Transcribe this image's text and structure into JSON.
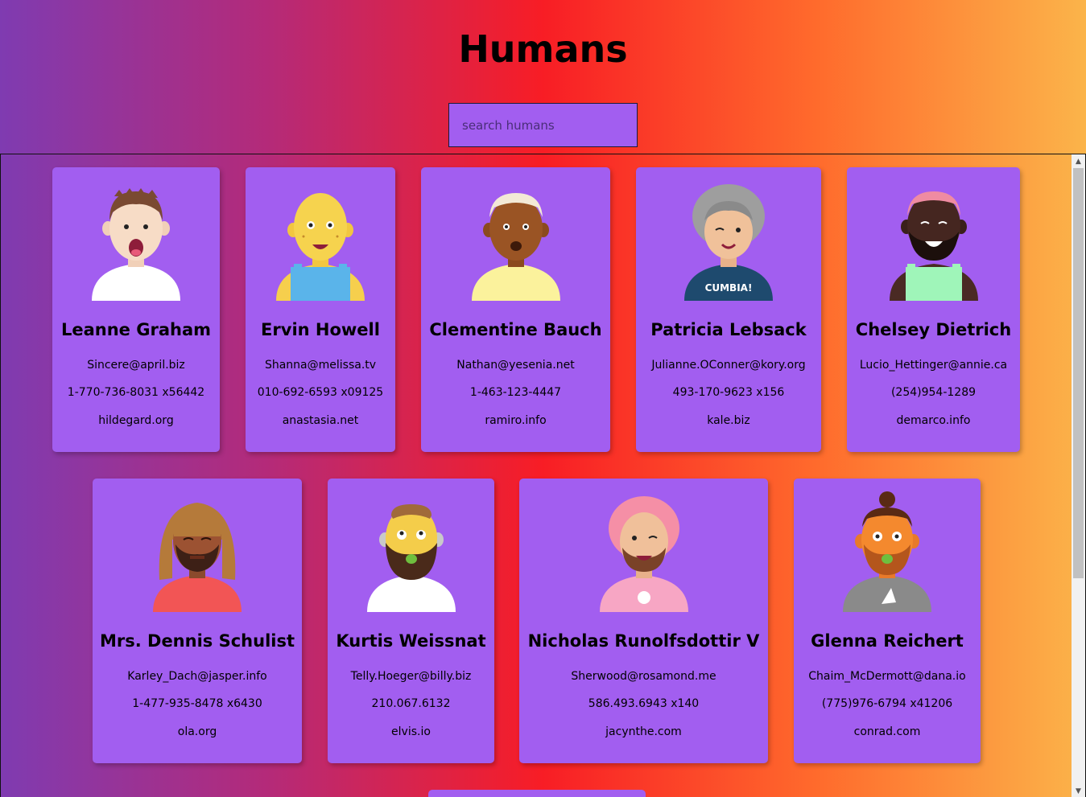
{
  "header": {
    "title": "Humans"
  },
  "search": {
    "placeholder": "search humans",
    "value": ""
  },
  "cards": [
    {
      "name": "Leanne Graham",
      "email": "Sincere@april.biz",
      "phone": "1-770-736-8031 x56442",
      "website": "hildegard.org"
    },
    {
      "name": "Ervin Howell",
      "email": "Shanna@melissa.tv",
      "phone": "010-692-6593 x09125",
      "website": "anastasia.net"
    },
    {
      "name": "Clementine Bauch",
      "email": "Nathan@yesenia.net",
      "phone": "1-463-123-4447",
      "website": "ramiro.info"
    },
    {
      "name": "Patricia Lebsack",
      "email": "Julianne.OConner@kory.org",
      "phone": "493-170-9623 x156",
      "website": "kale.biz",
      "shirt_text": "CUMBIA!"
    },
    {
      "name": "Chelsey Dietrich",
      "email": "Lucio_Hettinger@annie.ca",
      "phone": "(254)954-1289",
      "website": "demarco.info"
    },
    {
      "name": "Mrs. Dennis Schulist",
      "email": "Karley_Dach@jasper.info",
      "phone": "1-477-935-8478 x6430",
      "website": "ola.org"
    },
    {
      "name": "Kurtis Weissnat",
      "email": "Telly.Hoeger@billy.biz",
      "phone": "210.067.6132",
      "website": "elvis.io"
    },
    {
      "name": "Nicholas Runolfsdottir V",
      "email": "Sherwood@rosamond.me",
      "phone": "586.493.6943 x140",
      "website": "jacynthe.com"
    },
    {
      "name": "Glenna Reichert",
      "email": "Chaim_McDermott@dana.io",
      "phone": "(775)976-6794 x41206",
      "website": "conrad.com"
    }
  ],
  "colors": {
    "card": "#a25ef0",
    "gradient": [
      "#7f3bb1",
      "#f81d25",
      "#fbb44a"
    ]
  }
}
